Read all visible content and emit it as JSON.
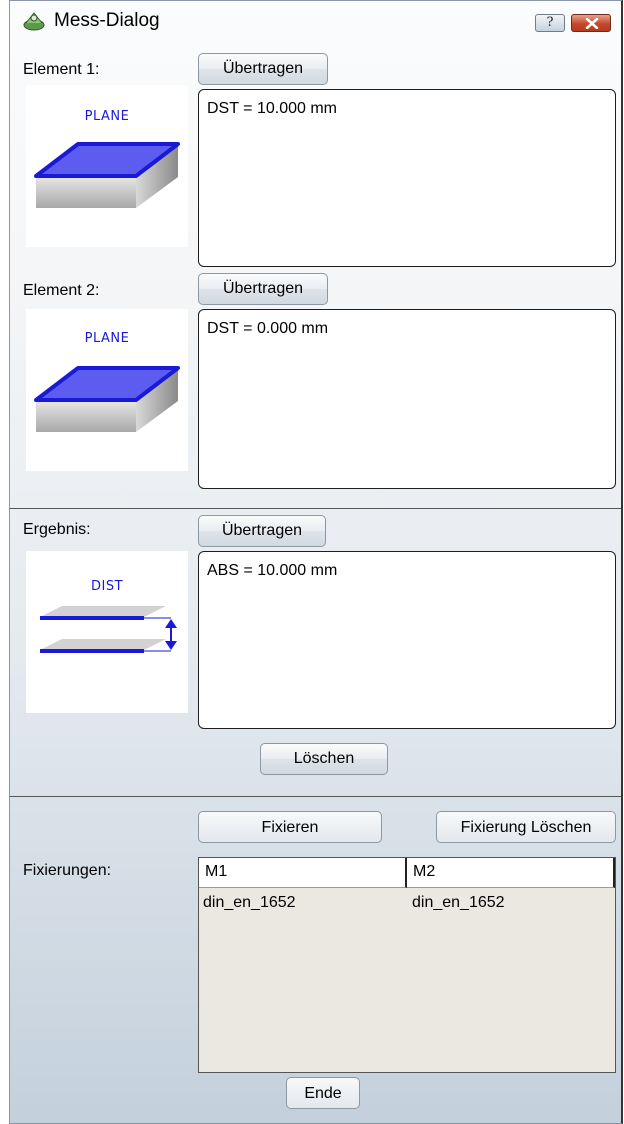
{
  "window": {
    "title": "Mess-Dialog",
    "help_label": "?"
  },
  "element1": {
    "label": "Element 1:",
    "button": "Übertragen",
    "picture_label": "PLANE",
    "value": "DST = 10.000 mm"
  },
  "element2": {
    "label": "Element 2:",
    "button": "Übertragen",
    "picture_label": "PLANE",
    "value": "DST = 0.000 mm"
  },
  "result": {
    "label": "Ergebnis:",
    "button": "Übertragen",
    "picture_label": "DIST",
    "value": "ABS = 10.000 mm",
    "clear_button": "Löschen"
  },
  "fixation": {
    "fix_button": "Fixieren",
    "clear_fix_button": "Fixierung Löschen",
    "label": "Fixierungen:",
    "columns": [
      "M1",
      "M2"
    ],
    "rows": [
      [
        "din_en_1652",
        "din_en_1652"
      ]
    ]
  },
  "end_button": "Ende",
  "colors": {
    "plane_blue": "#1a1ad6",
    "plane_fill": "#5c5cf0",
    "close_red": "#c4492d"
  },
  "icons": {
    "app": "measure-tool-icon",
    "help": "help-icon",
    "close": "close-icon"
  }
}
